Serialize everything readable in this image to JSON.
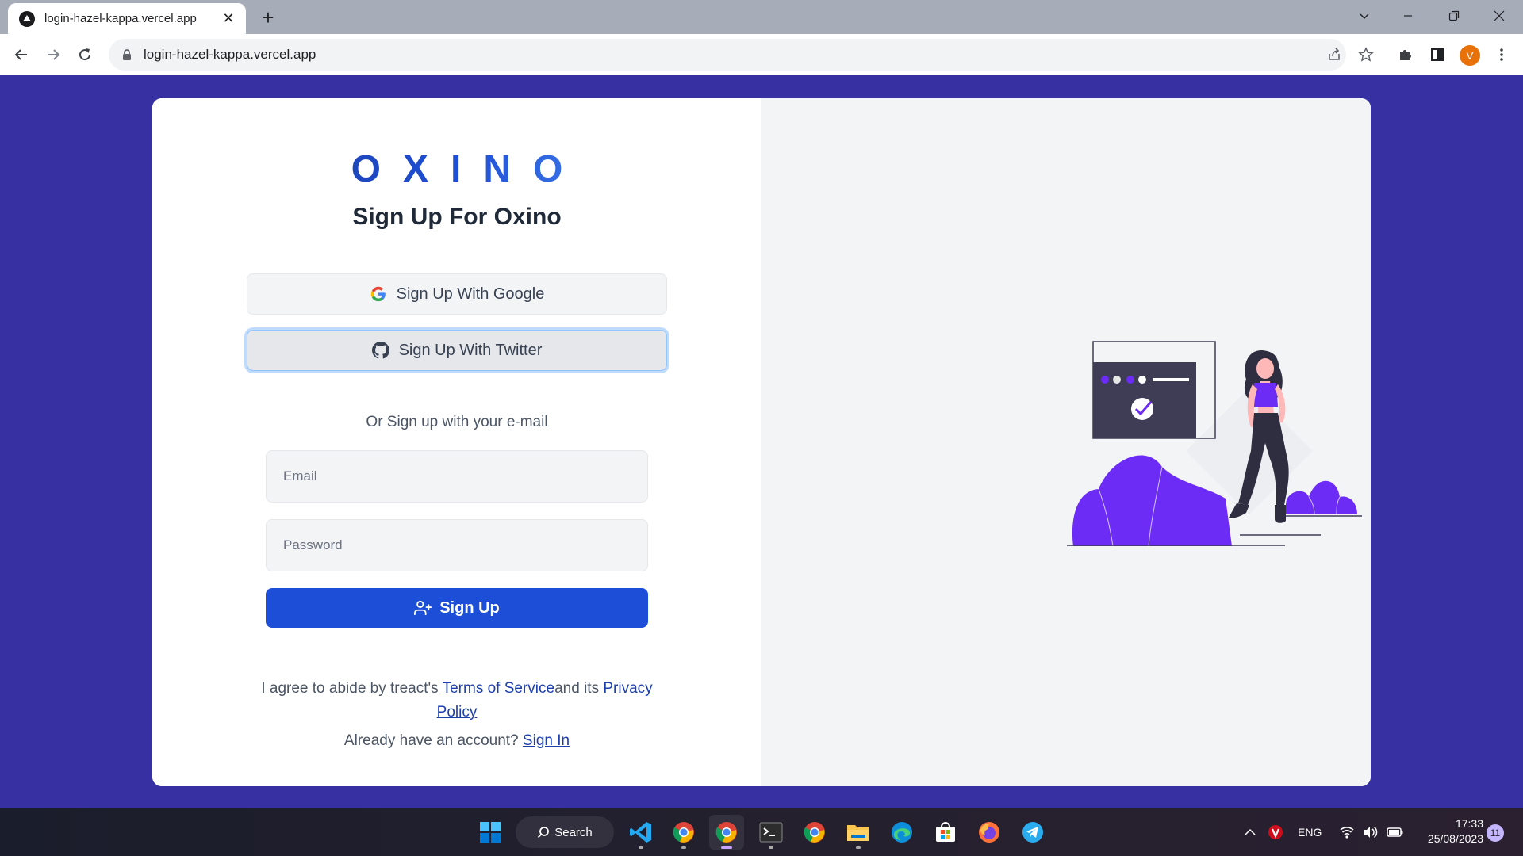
{
  "browser": {
    "tab_title": "login-hazel-kappa.vercel.app",
    "tab_close": "✕",
    "new_tab": "+",
    "url": "login-hazel-kappa.vercel.app",
    "profile_initial": "V"
  },
  "page": {
    "logo": "OXINO",
    "heading": "Sign Up For Oxino",
    "google_button": "Sign Up With Google",
    "twitter_button": "Sign Up With Twitter",
    "or_text": "Or Sign up with your e-mail",
    "email_placeholder": "Email",
    "password_placeholder": "Password",
    "signup_button": "Sign Up",
    "terms_prefix": "I agree to abide by treact's",
    "terms_link": "Terms of Service",
    "terms_middle": "and its",
    "privacy_link": "Privacy Policy",
    "account_prefix": "Already have an account?",
    "signin_link": "Sign In"
  },
  "colors": {
    "background": "#3730a3",
    "primary_button": "#1d4ed8",
    "illustration_accent": "#6c2cf5"
  },
  "taskbar": {
    "search_label": "Search",
    "language": "ENG",
    "time": "17:33",
    "date": "25/08/2023",
    "notification_count": "11",
    "apps": [
      "windows-start",
      "vscode",
      "chrome-profile-1",
      "chrome-profile-2",
      "terminal",
      "chrome",
      "file-explorer",
      "edge",
      "microsoft-store",
      "firefox",
      "telegram"
    ]
  }
}
